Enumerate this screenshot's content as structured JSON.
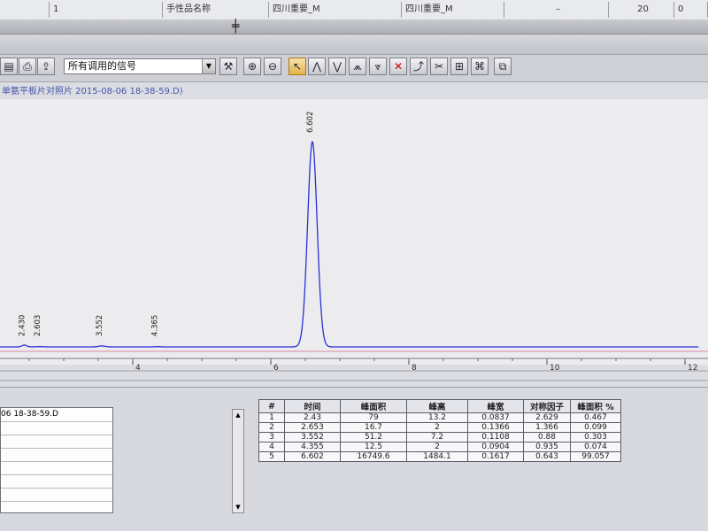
{
  "top_row": {
    "cells": [
      "1",
      "手性品名称",
      "四川重要_M",
      "四川重要_M",
      "–",
      "20",
      "0"
    ]
  },
  "toolbar": {
    "signal_select": "所有调用的信号",
    "icons": [
      "open-icon",
      "print-icon",
      "export-icon",
      "signal-dropdown",
      "tune-icon",
      "zoom-in-icon",
      "zoom-out-icon",
      "select-cursor-icon",
      "peak-integrate-icon",
      "baseline-icon",
      "split-peak-icon",
      "multi-peak-icon",
      "delete-peak-icon",
      "manual-icon",
      "tangent-icon",
      "calibrate-icon",
      "report-icon",
      "spectrum-icon"
    ]
  },
  "chromatogram": {
    "file_label": "单氨平板片对照片 2015-08-06 18-38-59.D)",
    "x_ticks": [
      "4",
      "6",
      "8",
      "10",
      "12"
    ],
    "peak_labels": [
      "2.430",
      "2.603",
      "3.552",
      "4.365",
      "6.602"
    ]
  },
  "chart_data": {
    "type": "line",
    "title": "",
    "xlabel": "",
    "ylabel": "",
    "xlim": [
      1.8,
      12.2
    ],
    "x_ticks": [
      4,
      6,
      8,
      10,
      12
    ],
    "peaks": [
      {
        "rt": 2.43,
        "height": 13.2,
        "width": 0.0837
      },
      {
        "rt": 2.653,
        "height": 2,
        "width": 0.1366
      },
      {
        "rt": 3.552,
        "height": 7.2,
        "width": 0.1108
      },
      {
        "rt": 4.355,
        "height": 2,
        "width": 0.0904
      },
      {
        "rt": 6.602,
        "height": 1484.1,
        "width": 0.1617
      }
    ],
    "ylim": [
      0,
      1600
    ],
    "color": "#2b2fd6"
  },
  "left_panel": {
    "item": "06 18-38-59.D"
  },
  "peak_table": {
    "headers": [
      "#",
      "时间",
      "峰面积",
      "峰高",
      "峰宽",
      "对称因子",
      "峰面积 %"
    ],
    "rows": [
      [
        "1",
        "2.43",
        "79",
        "13.2",
        "0.0837",
        "2.629",
        "0.467"
      ],
      [
        "2",
        "2.653",
        "16.7",
        "2",
        "0.1366",
        "1.366",
        "0.099"
      ],
      [
        "3",
        "3.552",
        "51.2",
        "7.2",
        "0.1108",
        "0.88",
        "0.303"
      ],
      [
        "4",
        "4.355",
        "12.5",
        "2",
        "0.0904",
        "0.935",
        "0.074"
      ],
      [
        "5",
        "6.602",
        "16749.6",
        "1484.1",
        "0.1617",
        "0.643",
        "99.057"
      ]
    ]
  }
}
